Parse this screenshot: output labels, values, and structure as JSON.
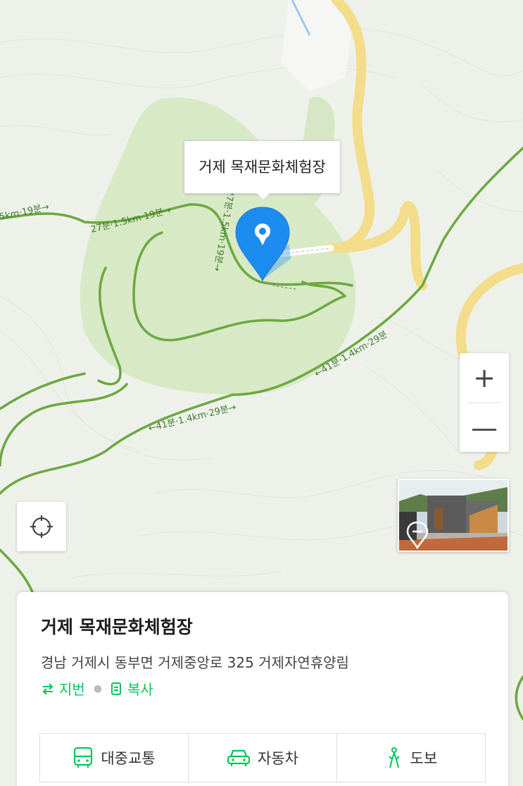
{
  "map": {
    "place_callout": "거제 목재문화체험장",
    "trail_labels": [
      "5km·19분→",
      "27분·1.5km·19분→",
      "←27분·1.5km·19분→",
      "←41분·1.4km·29분",
      "←41분·1.4km·29분→"
    ],
    "zoom_in_label": "+",
    "zoom_out_label": "—",
    "colors": {
      "trail": "#6ba83e",
      "road": "#f3dc8a",
      "park": "#d8e9c6",
      "pin": "#1d8cf0"
    }
  },
  "controls": {
    "zoom_in_icon": "plus-icon",
    "zoom_out_icon": "minus-icon",
    "locate_icon": "crosshair-icon",
    "streetview_icon": "panorama-pin-icon"
  },
  "place": {
    "name": "거제 목재문화체험장",
    "address": "경남 거제시 동부면 거제중앙로 325 거제자연휴양림",
    "jibun_label": "지번",
    "copy_label": "복사",
    "accent": "#03c75a"
  },
  "transport": {
    "public_transit": "대중교통",
    "car": "자동차",
    "walk": "도보"
  }
}
